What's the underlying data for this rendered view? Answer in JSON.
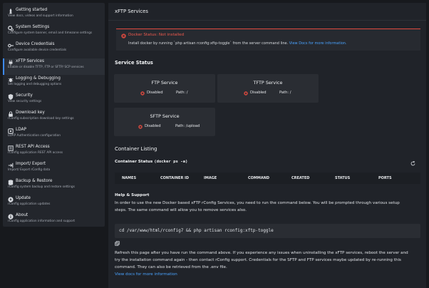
{
  "sidebar": {
    "items": [
      {
        "title": "Getting started",
        "desc": "View docs, videos and support information",
        "icon": "rocket-icon"
      },
      {
        "title": "System Settings",
        "desc": "Configure system banner, email and timezone settings",
        "icon": "cogs-icon"
      },
      {
        "title": "Device Credentials",
        "desc": "Configure available device credentials",
        "icon": "key-icon"
      },
      {
        "title": "xFTP Services",
        "desc": "Enable or disable TFTP, FTP or SFTP/ SCP services",
        "icon": "plug-icon"
      },
      {
        "title": "Logging & Debugging",
        "desc": "Set logging and debugging options",
        "icon": "bug-icon"
      },
      {
        "title": "Security",
        "desc": "View security settings",
        "icon": "shield-icon"
      },
      {
        "title": "Download key",
        "desc": "rConfig subscription download key settings",
        "icon": "lock-icon"
      },
      {
        "title": "LDAP",
        "desc": "LDAP Authentication configuration",
        "icon": "ldap-icon"
      },
      {
        "title": "REST API Access",
        "desc": "rConfig application REST API access",
        "icon": "api-icon"
      },
      {
        "title": "Import/ Export",
        "desc": "Import/ Export rConfig data",
        "icon": "import-export-icon"
      },
      {
        "title": "Backup & Restore",
        "desc": "rConfig system backup and restore settings",
        "icon": "backup-icon"
      },
      {
        "title": "Update",
        "desc": "rConfig application updates",
        "icon": "update-icon"
      },
      {
        "title": "About",
        "desc": "rConfig application information and support",
        "icon": "info-icon"
      }
    ]
  },
  "page": {
    "title": "xFTP Services",
    "alert": {
      "title": "Docker Status: Not installed",
      "body": "Install docker by running `php artisan rconfig:xftp-toggle` from the server command line.",
      "link": "View Docs for more information."
    },
    "service_status_title": "Service Status",
    "services": [
      {
        "name": "FTP Service",
        "status": "Disabled",
        "path": "Path: /"
      },
      {
        "name": "TFTP Service",
        "status": "Disabled",
        "path": "Path: /"
      },
      {
        "name": "SFTP Service",
        "status": "Disabled",
        "path": "Path: /upload"
      }
    ],
    "container_listing_title": "Container Listing",
    "container_status_label": "Container Status",
    "container_status_cmd": "(docker ps -a)",
    "table_columns": [
      "NAMES",
      "CONTAINER ID",
      "IMAGE",
      "COMMAND",
      "CREATED",
      "STATUS",
      "PORTS"
    ],
    "help": {
      "title": "Help & Support",
      "intro_line1": "In order to use the new Docker based xFTP rConfig Services, you need to run the command below. You will be prompted through various setup",
      "intro_line2": "steps. The same command will allow you to remove services also.",
      "command": "cd /var/www/html/rconfig7 && php artisan rconfig:xftp-toggle",
      "refresh_line1": "Refresh this page after you have run the command above. If you experience any issues when uninstalling the xFTP services, reboot the server and",
      "refresh_line2": "try the installation command again - then contact rConfig support. Credentials for the SFTP and FTP services maybe updated by re-running this",
      "refresh_line3": "command. They can also be retrieved from the .env file.",
      "docs_link": "View docs for more information"
    }
  },
  "colors": {
    "accent": "#3d8bfd",
    "danger": "#e04a3f",
    "link": "#4aa3ff"
  }
}
